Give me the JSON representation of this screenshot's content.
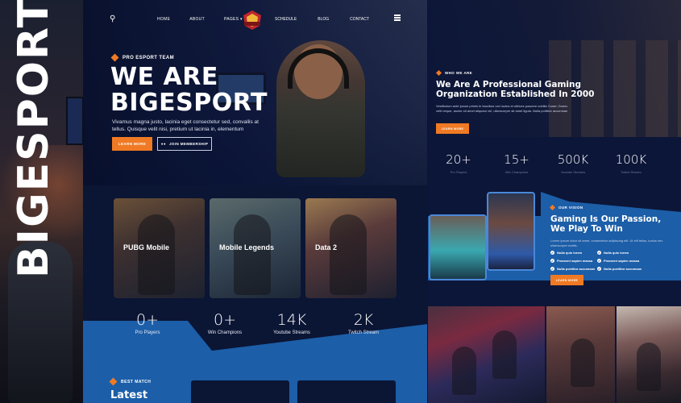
{
  "brand": {
    "vertical_title": "BIGESPORT"
  },
  "nav": {
    "left_links": [
      "HOME",
      "ABOUT",
      "PAGES ▾"
    ],
    "right_links": [
      "SCHEDULE",
      "BLOG",
      "CONTACT"
    ]
  },
  "hero": {
    "tag": "PRO ESPORT TEAM",
    "title_line1": "WE ARE",
    "title_line2": "BIGESPORT",
    "description": "Vivamus magna justo, lacinia eget consectetur sed, convallis at tellus. Quisque velit nisi, pretium ut lacinia in, elementum",
    "learn_more": "LEARN MORE",
    "join": "JOIN MEMBERSHIP"
  },
  "games": [
    {
      "title": "PUBG Mobile"
    },
    {
      "title": "Mobile Legends"
    },
    {
      "title": "Data 2"
    }
  ],
  "stats": [
    {
      "num": "0+",
      "label": "Pro Players"
    },
    {
      "num": "0+",
      "label": "Win Champions"
    },
    {
      "num": "14K",
      "label": "Youtube Streams"
    },
    {
      "num": "2K",
      "label": "Twitch Stream"
    }
  ],
  "best_match": {
    "tag": "BEST MATCH",
    "title": "Latest"
  },
  "about": {
    "tag": "WHO WE ARE",
    "title": "We Are A Professional Gaming Organization Established In 2000",
    "description": "Vestibulum ante ipsum primis in faucibus orci luctus et ultrices posuere cubilia Curae; Donec velit neque, auctor sit amet aliquam vel, ullamcorper sit amet ligula. Nulla porttitor accumsan",
    "button": "LEARN MORE",
    "stats": [
      {
        "num": "20+",
        "label": "Pro Players"
      },
      {
        "num": "15+",
        "label": "Win Champions"
      },
      {
        "num": "500K",
        "label": "Youtube Streams"
      },
      {
        "num": "100K",
        "label": "Twitch Stream"
      }
    ]
  },
  "vision": {
    "tag": "OUR VISION",
    "title": "Gaming Is Our Passion, We Play To Win",
    "description": "Lorem ipsum dolor sit amet, consectetur adipiscing elit. Ut elit tellus, luctus nec ullamcorper mattis.",
    "checks": [
      "Nulla quis lorem",
      "Nulla quis lorem",
      "Praesent sapien massa",
      "Praesent sapien massa",
      "Nulla porttitor accumsan",
      "Nulla porttitor accumsan"
    ],
    "button": "LEARN MORE"
  },
  "colors": {
    "accent": "#f07a24",
    "navy": "#0b1534",
    "band_blue": "#1c5ea8"
  }
}
